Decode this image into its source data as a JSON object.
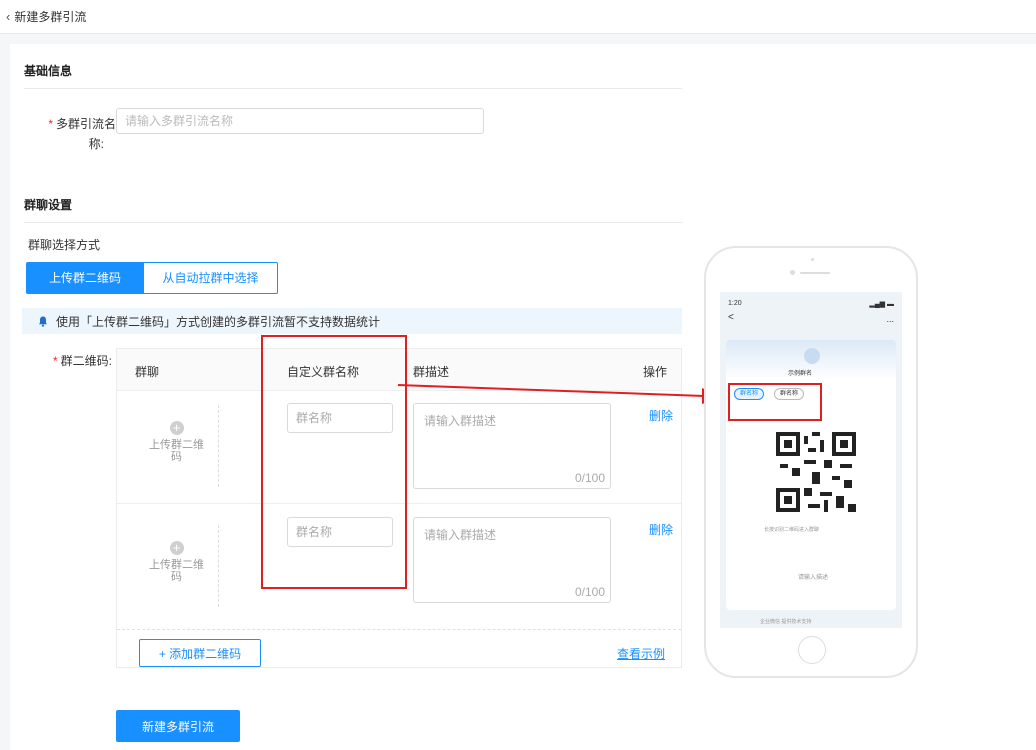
{
  "header": {
    "back_label": "新建多群引流"
  },
  "basic": {
    "section_title": "基础信息",
    "name_label_line1": "多群引流名",
    "name_label_line2": "称:",
    "name_placeholder": "请输入多群引流名称"
  },
  "group_settings": {
    "section_title": "群聊设置",
    "mode_label": "群聊选择方式",
    "modes": [
      "上传群二维码",
      "从自动拉群中选择"
    ],
    "active_mode": "上传群二维码",
    "notice": "使用「上传群二维码」方式创建的多群引流暂不支持数据统计",
    "qr_label": "群二维码:",
    "table": {
      "headers": [
        "群聊",
        "自定义群名称",
        "群描述",
        "操作"
      ],
      "rows": [
        {
          "upload_label": "上传群二维码",
          "name_placeholder": "群名称",
          "desc_placeholder": "请输入群描述",
          "counter": "0/100",
          "action": "删除"
        },
        {
          "upload_label": "上传群二维码",
          "name_placeholder": "群名称",
          "desc_placeholder": "请输入群描述",
          "counter": "0/100",
          "action": "删除"
        }
      ]
    },
    "add_button": "+ 添加群二维码",
    "example_link": "查看示例"
  },
  "submit_button": "新建多群引流",
  "phone_preview": {
    "time": "1:20",
    "back_glyph": "<",
    "more_glyph": "...",
    "card_title": "示例群名",
    "chips": [
      "群名称",
      "群名称"
    ],
    "scan_tip": "长按识别二维码进入群聊",
    "desc_tip": "请输入描述",
    "footer_tip": "企业微信 提供技术支持"
  },
  "colors": {
    "accent": "#1890ff",
    "highlight": "#e02020",
    "required": "#f5222d"
  }
}
